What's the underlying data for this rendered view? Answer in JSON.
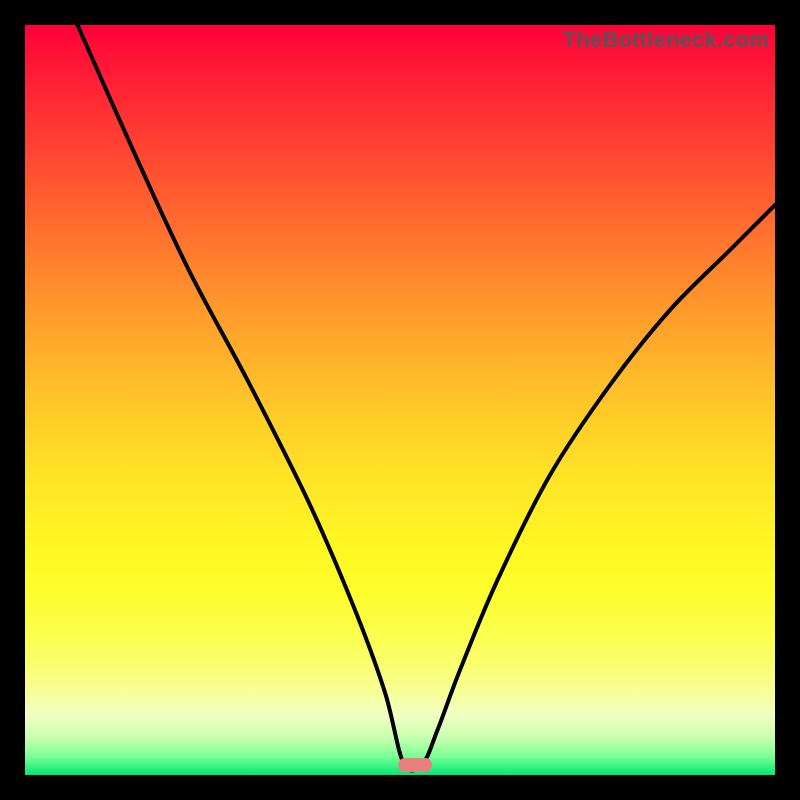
{
  "watermark": "TheBottleneck.com",
  "chart_data": {
    "type": "line",
    "title": "",
    "xlabel": "",
    "ylabel": "",
    "xlim": [
      0,
      100
    ],
    "ylim": [
      0,
      100
    ],
    "grid": false,
    "series": [
      {
        "name": "curve",
        "x": [
          7,
          15,
          22,
          30,
          38,
          44,
          48,
          50.5,
          53,
          55,
          58,
          63,
          70,
          78,
          86,
          94,
          100
        ],
        "values": [
          100,
          82,
          67,
          52,
          36,
          22,
          11,
          1.5,
          1.5,
          6,
          14,
          26,
          40,
          52,
          62,
          70,
          76
        ]
      }
    ],
    "marker": {
      "x": 52,
      "y": 1.3,
      "color": "#e98080"
    },
    "gradient_stops": [
      {
        "pos": 0,
        "color": "#ff0038"
      },
      {
        "pos": 50,
        "color": "#ffd228"
      },
      {
        "pos": 100,
        "color": "#00e873"
      }
    ]
  }
}
